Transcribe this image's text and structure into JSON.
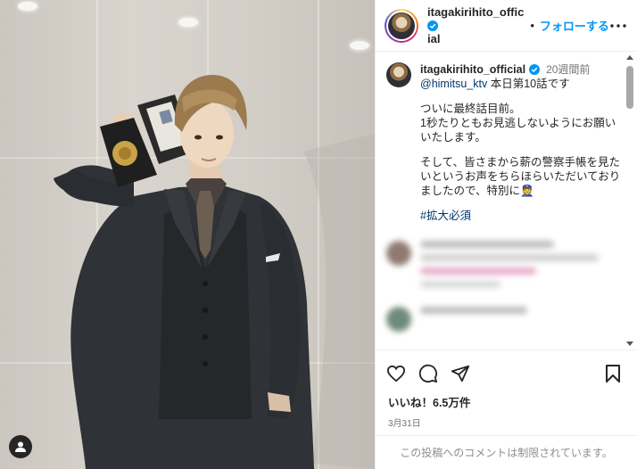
{
  "post": {
    "username": "itagakirihito_official",
    "username_line1": "itagakirihito_offic",
    "username_line2": "ial",
    "dot": "•",
    "follow_label": "フォローする",
    "more_icon": "more-horizontal-icon"
  },
  "caption": {
    "username": "itagakirihito_official",
    "time": "20週間前",
    "mention": "@himitsu_ktv",
    "line1": " 本日第10話です",
    "para1": "ついに最終話目前。\n1秒たりともお見逃しないようにお願いいたします。",
    "para2": "そして、皆さまから薪の警察手帳を見たいというお声をちらほらいただいておりましたので、特別に👮",
    "hashtag": "#拡大必須"
  },
  "actions": {
    "likes": "いいね！6.5万件",
    "date": "3月31日",
    "comments_disabled": "この投稿へのコメントは制限されています。"
  },
  "colors": {
    "accent": "#0095f6",
    "link": "#00376b",
    "verified": "#0095f6",
    "muted": "#737373"
  }
}
